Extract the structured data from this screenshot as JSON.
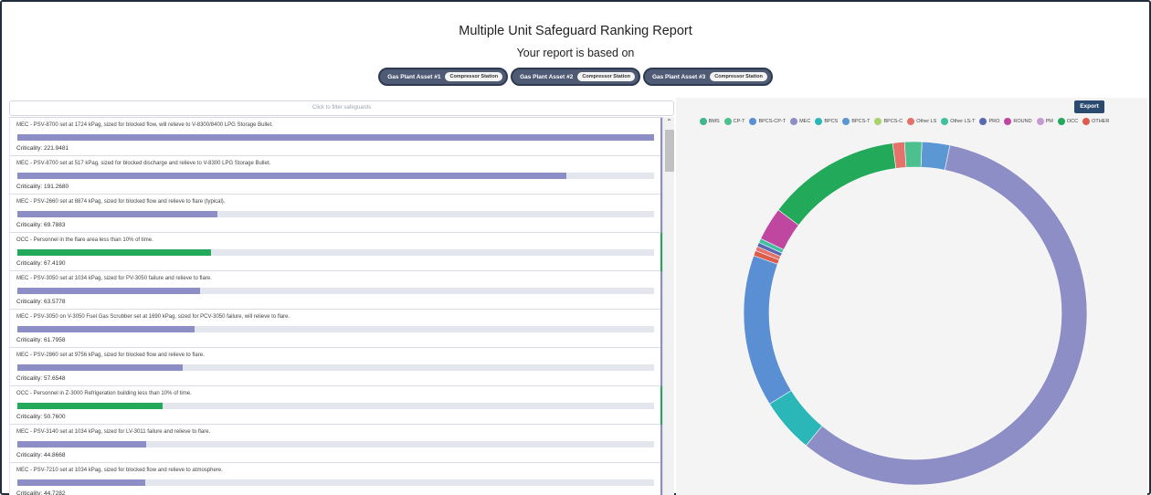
{
  "header": {
    "title": "Multiple Unit Safeguard Ranking Report",
    "subtitle": "Your report is based on",
    "assets": [
      {
        "name": "Gas Plant Asset #1",
        "tag": "Compressor Station"
      },
      {
        "name": "Gas Plant Asset #2",
        "tag": "Compressor Station"
      },
      {
        "name": "Gas Plant Asset #3",
        "tag": "Compressor Station"
      }
    ]
  },
  "filter": {
    "placeholder": "Click to filter safeguards"
  },
  "safeguards": [
    {
      "text": "MEC - PSV-8700 set at 1724 kPag, sized for blocked flow, will relieve to V-8300/8400 LPG Storage Bullet.",
      "criticality_label": "Criticality: 221.9481",
      "criticality": 221.9481,
      "type": "MEC"
    },
    {
      "text": "MEC - PSV-8700 set at 517 kPag, sized for blocked discharge and relieve to V-8300 LPG Storage Bullet.",
      "criticality_label": "Criticality: 191.2680",
      "criticality": 191.268,
      "type": "MEC"
    },
    {
      "text": "MEC - PSV-2660 set at 8874 kPag, sized for blocked flow and relieve to flare (typical).",
      "criticality_label": "Criticality: 69.7883",
      "criticality": 69.7883,
      "type": "MEC"
    },
    {
      "text": "OCC - Personnel in the flare area less than 10% of time.",
      "criticality_label": "Criticality: 67.4190",
      "criticality": 67.419,
      "type": "OCC"
    },
    {
      "text": "MEC - PSV-3050 set at 1034 kPag, sized for PV-3050 failure and relieve to flare.",
      "criticality_label": "Criticality: 63.5778",
      "criticality": 63.5778,
      "type": "MEC"
    },
    {
      "text": "MEC - PSV-3050 on V-3050 Fuel Gas Scrubber set at 1690 kPag, sized for PCV-3050 failure, will relieve to flare.",
      "criticality_label": "Criticality: 61.7958",
      "criticality": 61.7958,
      "type": "MEC"
    },
    {
      "text": "MEC - PSV-2860 set at 9756 kPag, sized for blocked flow and relieve to flare.",
      "criticality_label": "Criticality: 57.6548",
      "criticality": 57.6548,
      "type": "MEC"
    },
    {
      "text": "OCC - Personnel in Z-3000 Refrigeration building less than 10% of time.",
      "criticality_label": "Criticality: 50.7600",
      "criticality": 50.76,
      "type": "OCC"
    },
    {
      "text": "MEC - PSV-3140 set at 1034 kPag, sized for LV-3011 failure and relieve to flare.",
      "criticality_label": "Criticality: 44.8668",
      "criticality": 44.8668,
      "type": "MEC"
    },
    {
      "text": "MEC - PSV-7210 set at 1034 kPag, sized for blocked flow and relieve to atmosphere.",
      "criticality_label": "Criticality: 44.7282",
      "criticality": 44.7282,
      "type": "MEC"
    }
  ],
  "colors": {
    "MEC": "#8e8ec6",
    "OCC": "#22a95a"
  },
  "export": {
    "label": "Export"
  },
  "chart_data": {
    "type": "pie",
    "legend": [
      {
        "label": "BMS",
        "color": "#41b68c"
      },
      {
        "label": "CP-T",
        "color": "#4cc08e"
      },
      {
        "label": "BPCS-CP-T",
        "color": "#5b8fd4"
      },
      {
        "label": "MEC",
        "color": "#8e8ec6"
      },
      {
        "label": "BPCS",
        "color": "#2bb6b8"
      },
      {
        "label": "BPCS-T",
        "color": "#5b97d2"
      },
      {
        "label": "BPCS-C",
        "color": "#a8d26a"
      },
      {
        "label": "Other LS",
        "color": "#e4716a"
      },
      {
        "label": "Other LS-T",
        "color": "#3fc1a0"
      },
      {
        "label": "PRO",
        "color": "#5a6ab2"
      },
      {
        "label": "ROUND",
        "color": "#c0479f"
      },
      {
        "label": "PM",
        "color": "#c89ad4"
      },
      {
        "label": "OCC",
        "color": "#22a95a"
      },
      {
        "label": "OTHER",
        "color": "#dd5c4c"
      }
    ],
    "slices": [
      {
        "label": "BPCS-T",
        "value": 2.6,
        "color": "#5b97d2"
      },
      {
        "label": "MEC",
        "value": 57.3,
        "color": "#8e8ec6"
      },
      {
        "label": "BPCS",
        "value": 5.1,
        "color": "#2bb6b8"
      },
      {
        "label": "BPCS-CP-T",
        "value": 14.2,
        "color": "#5b8fd4"
      },
      {
        "label": "OTHER",
        "value": 0.5,
        "color": "#dd5c4c"
      },
      {
        "label": "Other LS",
        "value": 0.4,
        "color": "#e4716a"
      },
      {
        "label": "PRO",
        "value": 0.4,
        "color": "#5a6ab2"
      },
      {
        "label": "Other LS-T",
        "value": 0.4,
        "color": "#3fc1a0"
      },
      {
        "label": "ROUND",
        "value": 3.1,
        "color": "#c0479f"
      },
      {
        "label": "OCC",
        "value": 12.5,
        "color": "#22a95a"
      },
      {
        "label": "Other LS",
        "value": 1.1,
        "color": "#e4716a"
      },
      {
        "label": "CP-T",
        "value": 1.6,
        "color": "#4cc08e"
      }
    ]
  }
}
